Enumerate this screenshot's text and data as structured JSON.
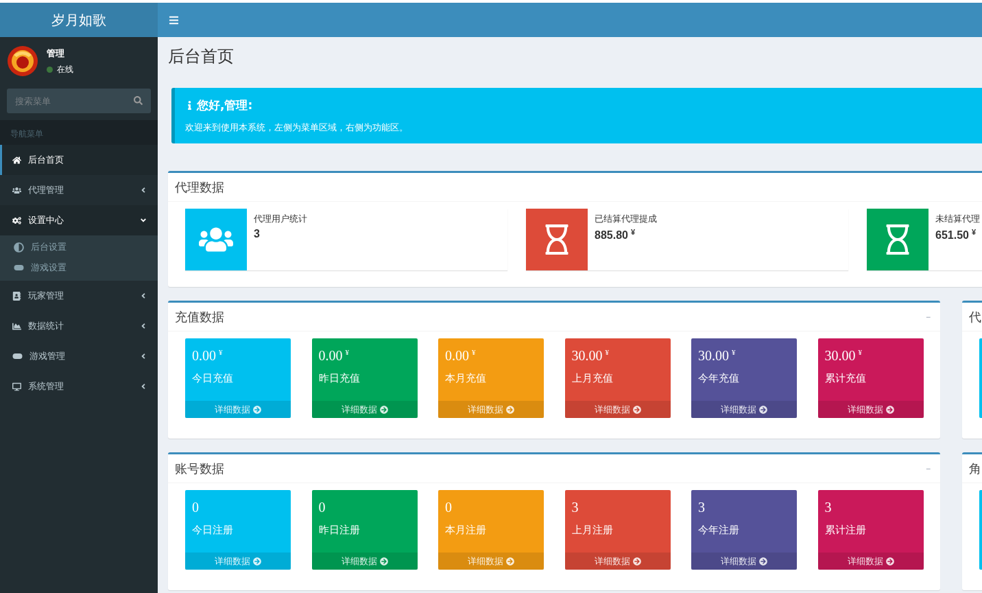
{
  "logo": "岁月如歌",
  "user": {
    "name": "管理",
    "status": "在线",
    "online": true
  },
  "search": {
    "placeholder": "搜索菜单"
  },
  "nav_header": "导航菜单",
  "menu": [
    {
      "label": "后台首页",
      "selected": true,
      "kind": "link"
    },
    {
      "label": "代理管理",
      "selected": false,
      "kind": "tree",
      "expanded": false
    },
    {
      "label": "设置中心",
      "selected": false,
      "kind": "tree",
      "expanded": true,
      "children": [
        {
          "label": "后台设置",
          "selected": false
        },
        {
          "label": "游戏设置",
          "selected": false
        }
      ]
    },
    {
      "label": "玩家管理",
      "selected": false,
      "kind": "tree",
      "expanded": false
    },
    {
      "label": "数据统计",
      "selected": false,
      "kind": "tree",
      "expanded": false
    },
    {
      "label": "游戏管理",
      "selected": false,
      "kind": "tree",
      "expanded": false
    },
    {
      "label": "系统管理",
      "selected": false,
      "kind": "tree",
      "expanded": false
    }
  ],
  "page_title": "后台首页",
  "callout": {
    "title": "您好,管理:",
    "text": "欢迎来到使用本系统，左侧为菜单区域，右侧为功能区。"
  },
  "agent_panel": {
    "title": "代理数据",
    "boxes": [
      {
        "label": "代理用户统计",
        "value": "3",
        "color": "#00c0ef"
      },
      {
        "label": "已结算代理提成",
        "value": "885.80",
        "unit": "¥",
        "color": "#dd4b39"
      },
      {
        "label": "未结算代理",
        "value": "651.50",
        "unit": "¥",
        "color": "#00a65a"
      }
    ]
  },
  "panels": [
    {
      "title": "充值数据",
      "collapse": "−",
      "tiles": [
        {
          "value": "0.00",
          "unit": "¥",
          "label": "今日充值",
          "link": "详细数据",
          "color": "#00c0ef"
        },
        {
          "value": "0.00",
          "unit": "¥",
          "label": "昨日充值",
          "link": "详细数据",
          "color": "#00a65a"
        },
        {
          "value": "0.00",
          "unit": "¥",
          "label": "本月充值",
          "link": "详细数据",
          "color": "#f39c12"
        },
        {
          "value": "30.00",
          "unit": "¥",
          "label": "上月充值",
          "link": "详细数据",
          "color": "#dd4b39"
        },
        {
          "value": "30.00",
          "unit": "¥",
          "label": "今年充值",
          "link": "详细数据",
          "color": "#555299"
        },
        {
          "value": "30.00",
          "unit": "¥",
          "label": "累计充值",
          "link": "详细数据",
          "color": "#ca195a"
        }
      ]
    },
    {
      "title": "账号数据",
      "collapse": "−",
      "tiles": [
        {
          "value": "0",
          "label": "今日注册",
          "link": "详细数据",
          "color": "#00c0ef"
        },
        {
          "value": "0",
          "label": "昨日注册",
          "link": "详细数据",
          "color": "#00a65a"
        },
        {
          "value": "0",
          "label": "本月注册",
          "link": "详细数据",
          "color": "#f39c12"
        },
        {
          "value": "3",
          "label": "上月注册",
          "link": "详细数据",
          "color": "#dd4b39"
        },
        {
          "value": "3",
          "label": "今年注册",
          "link": "详细数据",
          "color": "#555299"
        },
        {
          "value": "3",
          "label": "累计注册",
          "link": "详细数据",
          "color": "#ca195a"
        }
      ]
    }
  ],
  "side_panels": [
    {
      "title": "代",
      "tiles": [
        {
          "color": "#00c0ef"
        }
      ]
    },
    {
      "title": "角",
      "tiles": [
        {
          "color": "#00c0ef"
        }
      ]
    }
  ]
}
